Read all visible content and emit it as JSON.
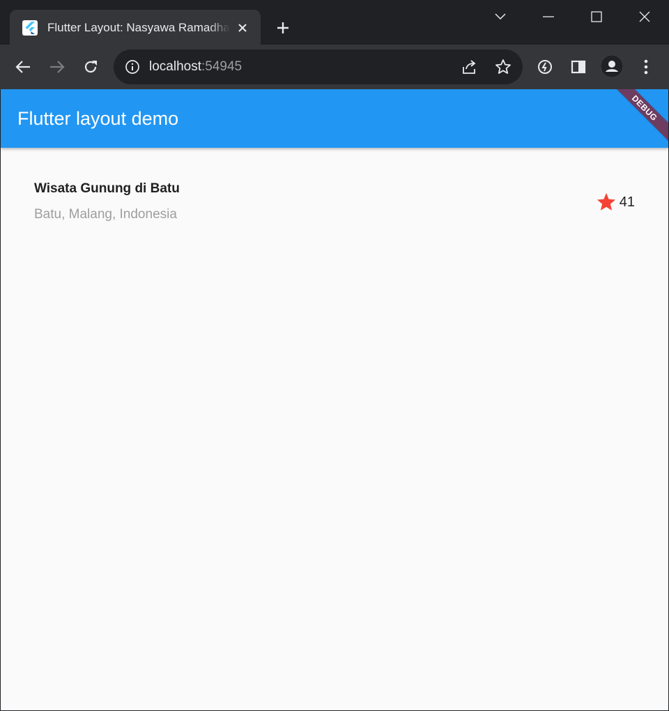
{
  "browser": {
    "tab_title": "Flutter Layout: Nasyawa Ramadhani",
    "url_host": "localhost",
    "url_port": ":54945"
  },
  "app": {
    "appbar_title": "Flutter layout demo",
    "debug_label": "DEBUG",
    "title_section": {
      "name": "Wisata Gunung di Batu",
      "location": "Batu, Malang, Indonesia",
      "favorite_count": "41"
    }
  },
  "colors": {
    "appbar": "#2196f3",
    "star": "#f44336",
    "subtitle": "#9e9e9e"
  },
  "icons": {
    "tab": "flutter-logo-icon",
    "rating": "star-icon"
  }
}
